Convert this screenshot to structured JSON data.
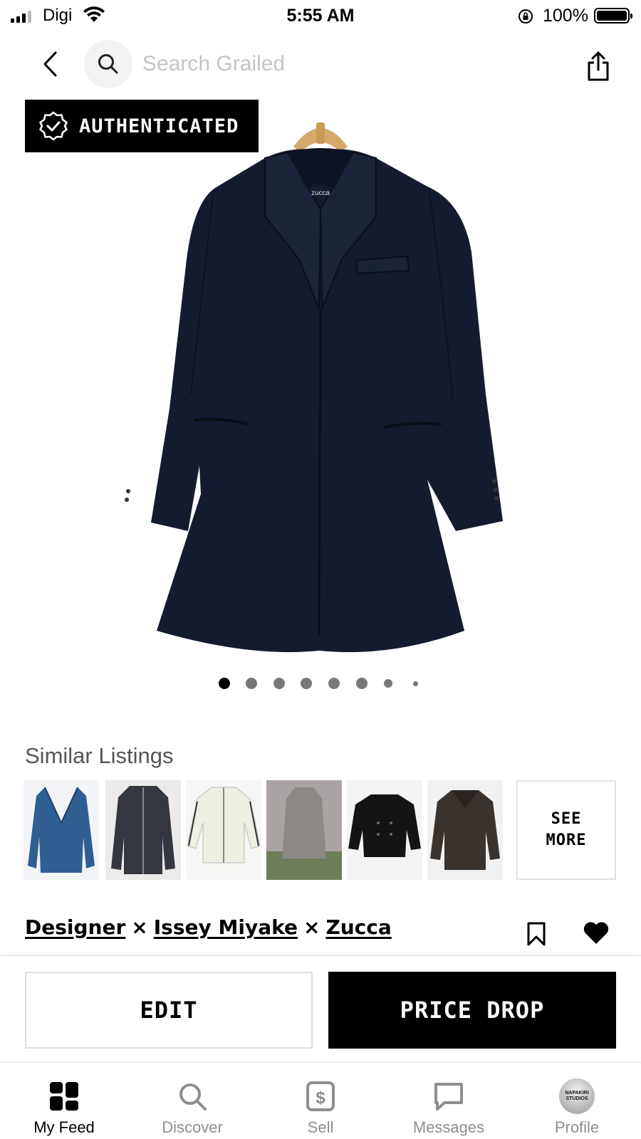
{
  "status_bar": {
    "carrier": "Digi",
    "time": "5:55 AM",
    "battery": "100%"
  },
  "nav": {
    "search_placeholder": "Search Grailed"
  },
  "product": {
    "badge": "AUTHENTICATED",
    "garment_label": "zucca",
    "image_count": 8,
    "current_image": 1
  },
  "similar": {
    "title": "Similar Listings",
    "see_more": "SEE\nMORE"
  },
  "designers": {
    "items": [
      "Designer",
      "Issey Miyake",
      "Zucca"
    ],
    "separator": "×"
  },
  "actions": {
    "edit": "EDIT",
    "price_drop": "PRICE DROP"
  },
  "tabs": [
    {
      "label": "My Feed",
      "icon": "feed-icon",
      "active": true
    },
    {
      "label": "Discover",
      "icon": "search-icon",
      "active": false
    },
    {
      "label": "Sell",
      "icon": "dollar-tag-icon",
      "active": false
    },
    {
      "label": "Messages",
      "icon": "chat-bubble-icon",
      "active": false
    },
    {
      "label": "Profile",
      "icon": "avatar",
      "active": false
    }
  ],
  "avatar_text": "NAPAKIRI STUDIOS",
  "colors": {
    "accent": "#000000",
    "muted": "#8e8e8e",
    "placeholder": "#c4c4c4"
  }
}
